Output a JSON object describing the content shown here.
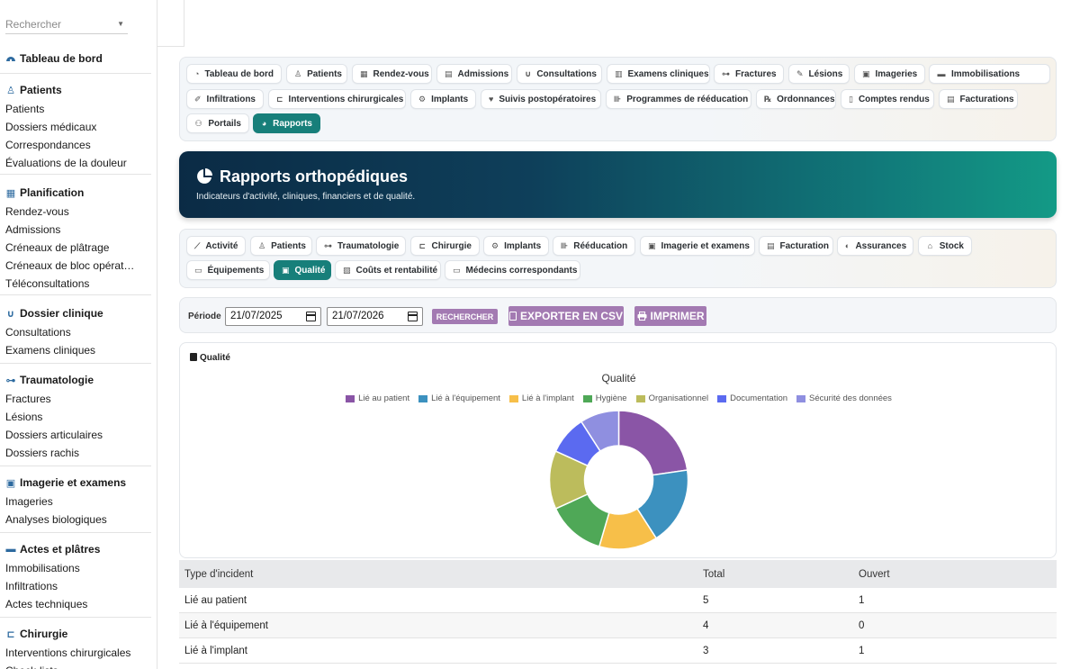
{
  "sidebar": {
    "search_placeholder": "Rechercher",
    "dashboard_label": "Tableau de bord",
    "sections": [
      {
        "title": "Patients",
        "icon": "user-injured-icon",
        "items": [
          "Patients",
          "Dossiers médicaux",
          "Correspondances",
          "Évaluations de la douleur"
        ]
      },
      {
        "title": "Planification",
        "icon": "calendar-icon",
        "items": [
          "Rendez-vous",
          "Admissions",
          "Créneaux de plâtrage",
          "Créneaux de bloc opérat…",
          "Téléconsultations"
        ]
      },
      {
        "title": "Dossier clinique",
        "icon": "stethoscope-icon",
        "items": [
          "Consultations",
          "Examens cliniques"
        ]
      },
      {
        "title": "Traumatologie",
        "icon": "bone-icon",
        "items": [
          "Fractures",
          "Lésions",
          "Dossiers articulaires",
          "Dossiers rachis"
        ]
      },
      {
        "title": "Imagerie et examens",
        "icon": "x-ray-icon",
        "items": [
          "Imageries",
          "Analyses biologiques"
        ]
      },
      {
        "title": "Actes et plâtres",
        "icon": "bandage-icon",
        "items": [
          "Immobilisations",
          "Infiltrations",
          "Actes techniques"
        ]
      },
      {
        "title": "Chirurgie",
        "icon": "procedures-icon",
        "items": [
          "Interventions chirurgicales",
          "Check-lists"
        ]
      }
    ]
  },
  "main_tabs": [
    {
      "label": "Tableau de bord",
      "icon": "dashboard-icon"
    },
    {
      "label": "Patients",
      "icon": "user-icon"
    },
    {
      "label": "Rendez-vous",
      "icon": "calendar-icon"
    },
    {
      "label": "Admissions",
      "icon": "clipboard-icon"
    },
    {
      "label": "Consultations",
      "icon": "stethoscope-icon"
    },
    {
      "label": "Examens cliniques",
      "icon": "file-medical-icon"
    },
    {
      "label": "Fractures",
      "icon": "bone-icon"
    },
    {
      "label": "Lésions",
      "icon": "band-aid-icon"
    },
    {
      "label": "Imageries",
      "icon": "x-ray-icon"
    },
    {
      "label": "Immobilisations",
      "icon": "bandage-icon"
    },
    {
      "label": "Infiltrations",
      "icon": "syringe-icon"
    },
    {
      "label": "Interventions chirurgicales",
      "icon": "procedures-icon"
    },
    {
      "label": "Implants",
      "icon": "cogs-icon"
    },
    {
      "label": "Suivis postopératoires",
      "icon": "heart-icon"
    },
    {
      "label": "Programmes de rééducation",
      "icon": "dumbbell-icon"
    },
    {
      "label": "Ordonnances",
      "icon": "prescription-icon"
    },
    {
      "label": "Comptes rendus",
      "icon": "file-icon"
    },
    {
      "label": "Facturations",
      "icon": "invoice-icon"
    },
    {
      "label": "Portails",
      "icon": "users-icon"
    },
    {
      "label": "Rapports",
      "icon": "chart-pie-icon",
      "active": true
    }
  ],
  "hero": {
    "title": "Rapports orthopédiques",
    "subtitle": "Indicateurs d'activité, cliniques, financiers et de qualité.",
    "icon": "chart-pie-icon"
  },
  "report_tabs": [
    {
      "label": "Activité",
      "icon": "chart-line-icon"
    },
    {
      "label": "Patients",
      "icon": "user-icon"
    },
    {
      "label": "Traumatologie",
      "icon": "bone-icon"
    },
    {
      "label": "Chirurgie",
      "icon": "procedures-icon"
    },
    {
      "label": "Implants",
      "icon": "cogs-icon"
    },
    {
      "label": "Rééducation",
      "icon": "dumbbell-icon"
    },
    {
      "label": "Imagerie et examens",
      "icon": "x-ray-icon"
    },
    {
      "label": "Facturation",
      "icon": "invoice-icon"
    },
    {
      "label": "Assurances",
      "icon": "shield-icon"
    },
    {
      "label": "Stock",
      "icon": "warehouse-icon"
    },
    {
      "label": "Équipements",
      "icon": "desktop-icon"
    },
    {
      "label": "Qualité",
      "icon": "clipboard-check-icon",
      "active": true
    },
    {
      "label": "Coûts et rentabilité",
      "icon": "coins-icon"
    },
    {
      "label": "Médecins correspondants",
      "icon": "id-card-icon"
    }
  ],
  "filters": {
    "period_label": "Période",
    "date_from": "21/07/2025",
    "date_to": "21/07/2026",
    "search_button": "RECHERCHER",
    "export_button": "EXPORTER EN CSV",
    "print_button": "IMPRIMER"
  },
  "chart_section": {
    "header": "Qualité"
  },
  "chart_data": {
    "type": "pie",
    "title": "Qualité",
    "donut": true,
    "legend_position": "top",
    "categories": [
      "Lié au patient",
      "Lié à l'équipement",
      "Lié à l'implant",
      "Hygiène",
      "Organisationnel",
      "Documentation",
      "Sécurité des données"
    ],
    "values": [
      5,
      4,
      3,
      3,
      3,
      2,
      2
    ],
    "colors": [
      "#8a55a6",
      "#3c91bf",
      "#f7bf49",
      "#4fa857",
      "#bcbc5c",
      "#5b6af0",
      "#8f8fe0"
    ]
  },
  "table": {
    "headers": [
      "Type d'incident",
      "Total",
      "Ouvert"
    ],
    "rows": [
      [
        "Lié au patient",
        "5",
        "1"
      ],
      [
        "Lié à l'équipement",
        "4",
        "0"
      ],
      [
        "Lié à l'implant",
        "3",
        "1"
      ]
    ]
  }
}
